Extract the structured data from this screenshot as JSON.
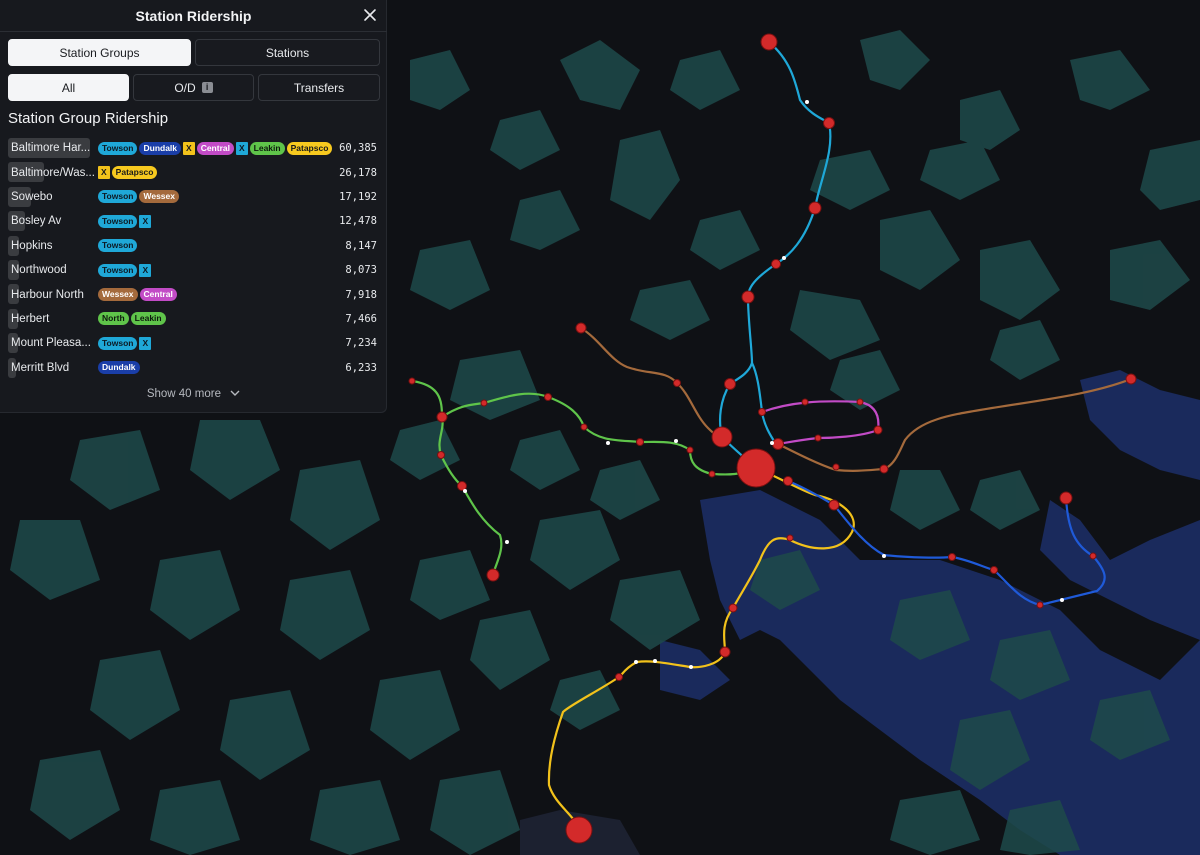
{
  "panel": {
    "title": "Station Ridership",
    "close_icon": "close-icon",
    "tabs": [
      {
        "label": "Station Groups",
        "active": true
      },
      {
        "label": "Stations",
        "active": false
      }
    ],
    "filters": [
      {
        "label": "All",
        "active": true
      },
      {
        "label": "O/D",
        "active": false,
        "info_glyph": "i"
      },
      {
        "label": "Transfers",
        "active": false
      }
    ],
    "section_title": "Station Group Ridership",
    "show_more": "Show 40 more",
    "show_more_icon": "chevron-down-icon"
  },
  "line_colors": {
    "Towson": "#1fa8d8",
    "Dundalk": "#1a3ea8",
    "X": "#f2c21b",
    "X_blue": "#1fa8d8",
    "Central": "#c24bc6",
    "Leakin": "#5fc44a",
    "Patapsco": "#f7c91f",
    "Wessex": "#a46a3c",
    "North": "#5fc44a"
  },
  "rows": [
    {
      "name": "Baltimore Har...",
      "value": "60,385",
      "ratio": 1.0,
      "lines": [
        {
          "label": "Towson",
          "color": "#1fa8d8",
          "text": "#0d1a24"
        },
        {
          "label": "Dundalk",
          "color": "#1a3ea8",
          "text": "#ffffff"
        },
        {
          "label": "X",
          "color": "#f2c21b",
          "text": "#1a1a1a",
          "square": true
        },
        {
          "label": "Central",
          "color": "#c24bc6",
          "text": "#ffffff"
        },
        {
          "label": "X",
          "color": "#1fa8d8",
          "text": "#0d1a24",
          "square": true
        },
        {
          "label": "Leakin",
          "color": "#5fc44a",
          "text": "#0d1a0d"
        },
        {
          "label": "Patapsco",
          "color": "#f7c91f",
          "text": "#1a1a1a"
        }
      ]
    },
    {
      "name": "Baltimore/Was...",
      "value": "26,178",
      "ratio": 0.433,
      "lines": [
        {
          "label": "X",
          "color": "#f2c21b",
          "text": "#1a1a1a",
          "square": true
        },
        {
          "label": "Patapsco",
          "color": "#f7c91f",
          "text": "#1a1a1a"
        }
      ]
    },
    {
      "name": "Sowebo",
      "value": "17,192",
      "ratio": 0.285,
      "lines": [
        {
          "label": "Towson",
          "color": "#1fa8d8",
          "text": "#0d1a24"
        },
        {
          "label": "Wessex",
          "color": "#a46a3c",
          "text": "#ffffff"
        }
      ]
    },
    {
      "name": "Bosley Av",
      "value": "12,478",
      "ratio": 0.207,
      "lines": [
        {
          "label": "Towson",
          "color": "#1fa8d8",
          "text": "#0d1a24"
        },
        {
          "label": "X",
          "color": "#1fa8d8",
          "text": "#0d1a24",
          "square": true
        }
      ]
    },
    {
      "name": "Hopkins",
      "value": "8,147",
      "ratio": 0.135,
      "lines": [
        {
          "label": "Towson",
          "color": "#1fa8d8",
          "text": "#0d1a24"
        }
      ]
    },
    {
      "name": "Northwood",
      "value": "8,073",
      "ratio": 0.134,
      "lines": [
        {
          "label": "Towson",
          "color": "#1fa8d8",
          "text": "#0d1a24"
        },
        {
          "label": "X",
          "color": "#1fa8d8",
          "text": "#0d1a24",
          "square": true
        }
      ]
    },
    {
      "name": "Harbour North",
      "value": "7,918",
      "ratio": 0.131,
      "lines": [
        {
          "label": "Wessex",
          "color": "#a46a3c",
          "text": "#ffffff"
        },
        {
          "label": "Central",
          "color": "#c24bc6",
          "text": "#ffffff"
        }
      ]
    },
    {
      "name": "Herbert",
      "value": "7,466",
      "ratio": 0.124,
      "lines": [
        {
          "label": "North",
          "color": "#5fc44a",
          "text": "#0d1a0d"
        },
        {
          "label": "Leakin",
          "color": "#5fc44a",
          "text": "#0d1a0d"
        }
      ]
    },
    {
      "name": "Mount Pleasa...",
      "value": "7,234",
      "ratio": 0.12,
      "lines": [
        {
          "label": "Towson",
          "color": "#1fa8d8",
          "text": "#0d1a24"
        },
        {
          "label": "X",
          "color": "#1fa8d8",
          "text": "#0d1a24",
          "square": true
        }
      ]
    },
    {
      "name": "Merritt Blvd",
      "value": "6,233",
      "ratio": 0.103,
      "lines": [
        {
          "label": "Dundalk",
          "color": "#1a3ea8",
          "text": "#ffffff"
        }
      ]
    }
  ]
}
